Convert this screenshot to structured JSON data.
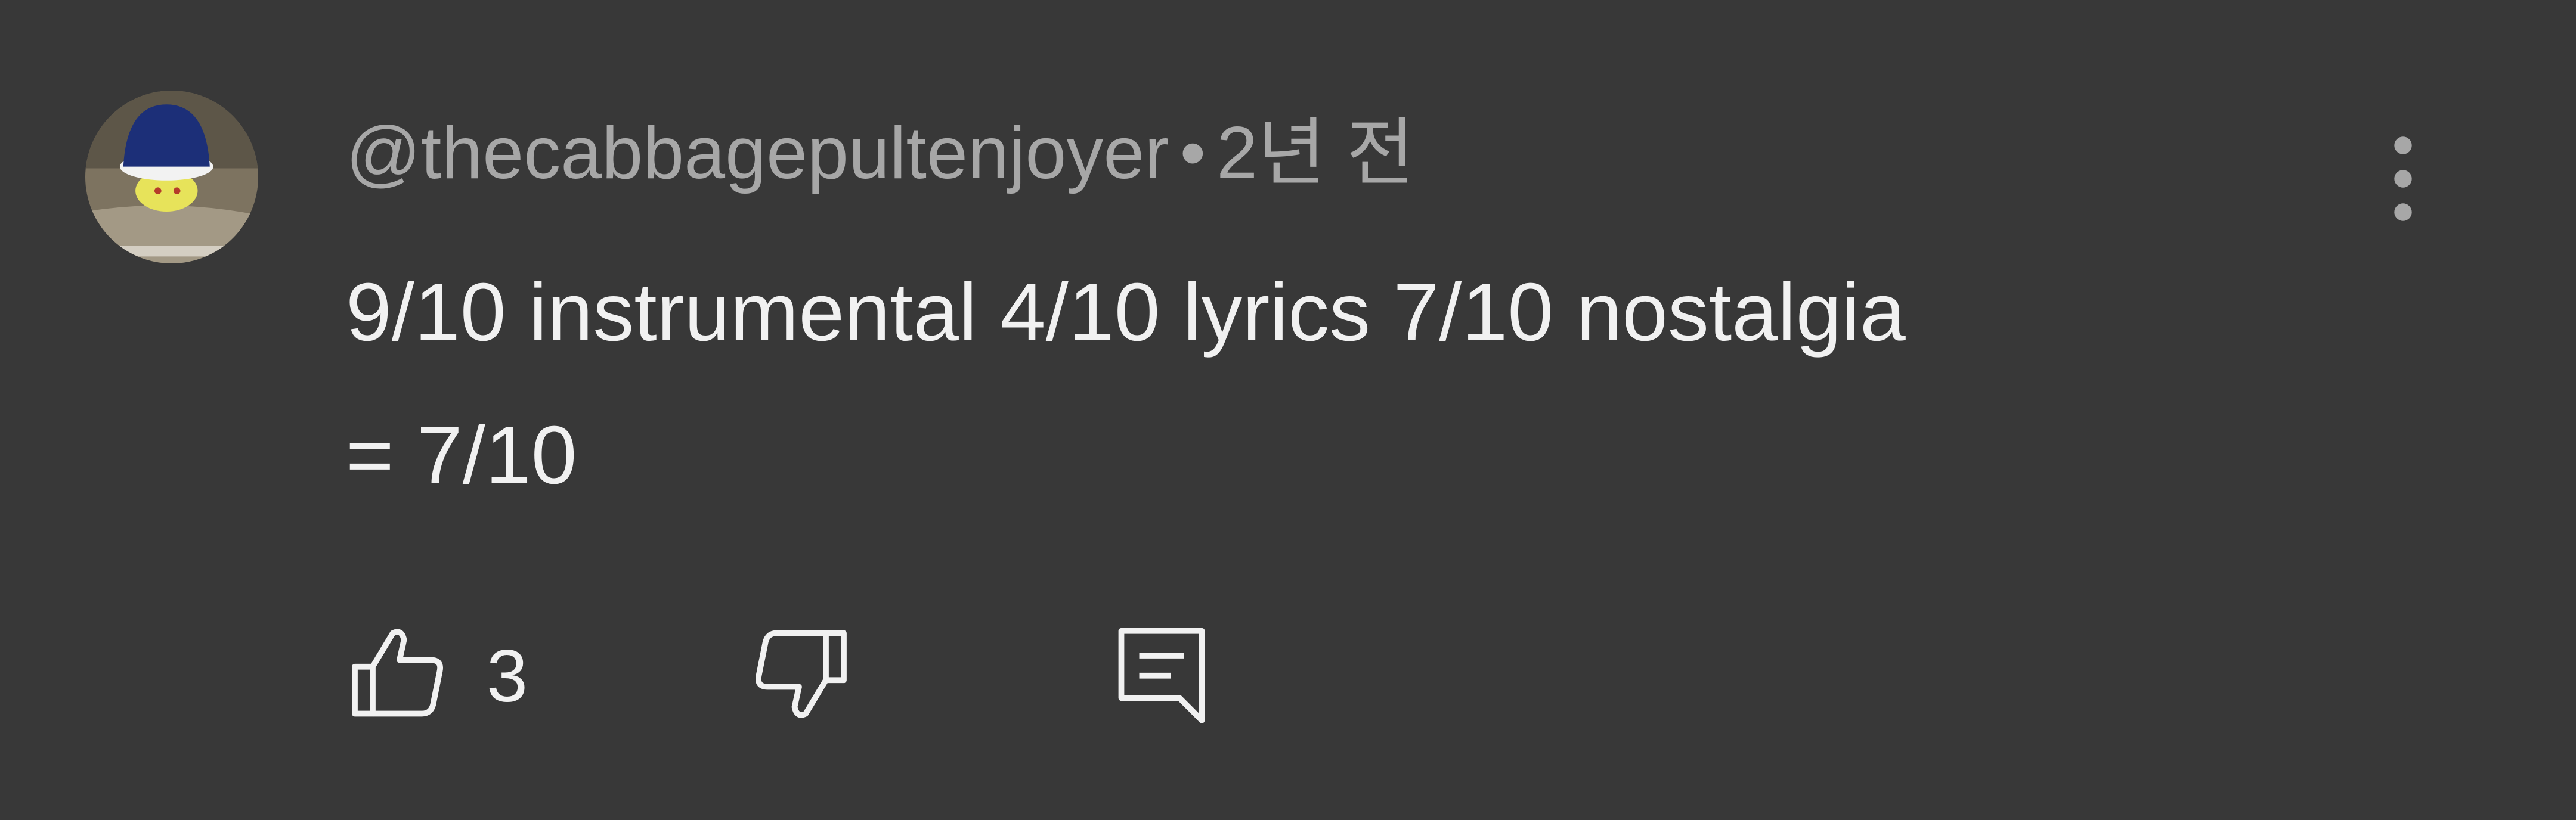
{
  "comment": {
    "author": "@thecabbagepultenjoyer",
    "separator": "•",
    "time_ago": "2년 전",
    "text_lines": [
      "9/10 instrumental 4/10 lyrics 7/10 nostalgia",
      "= 7/10"
    ],
    "like_count": "3"
  },
  "icons": {
    "avatar": "avatar-image",
    "menu": "more-vert-icon",
    "like": "thumbs-up-icon",
    "dislike": "thumbs-down-icon",
    "reply": "comment-reply-icon"
  },
  "colors": {
    "background": "#383838",
    "meta_text": "#a7a7a7",
    "body_text": "#f1f1f1",
    "icon": "#f1f1f1"
  }
}
